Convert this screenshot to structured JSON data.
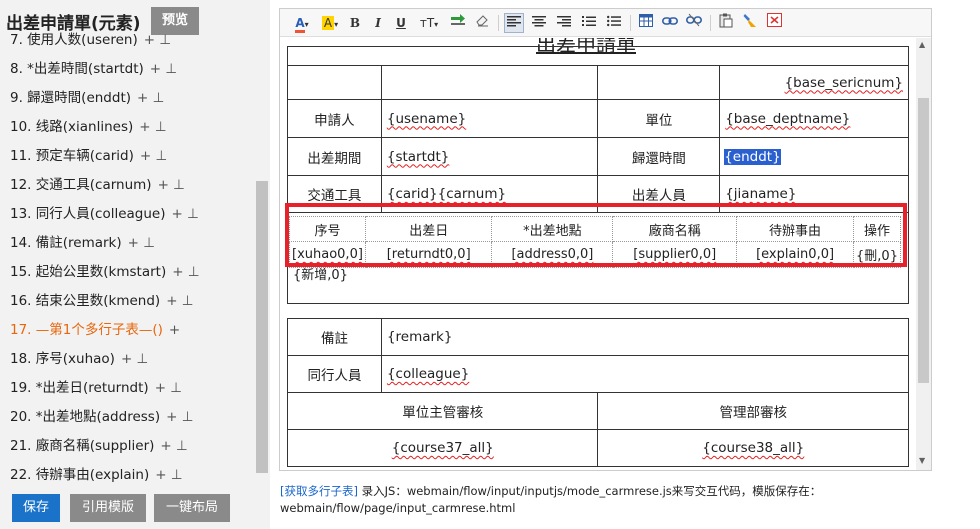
{
  "header": {
    "title": "出差申請單(元素)",
    "preview_label": "预览"
  },
  "field_list": [
    {
      "text": "7. 使用人数(useren)",
      "op": "+ ⊥",
      "sub": false
    },
    {
      "text": "8. *出差時間(startdt)",
      "op": "+ ⊥",
      "sub": false
    },
    {
      "text": "9. 歸還時間(enddt)",
      "op": "+ ⊥",
      "sub": false
    },
    {
      "text": "10. 线路(xianlines)",
      "op": "+ ⊥",
      "sub": false
    },
    {
      "text": "11. 预定车辆(carid)",
      "op": "+ ⊥",
      "sub": false
    },
    {
      "text": "12. 交通工具(carnum)",
      "op": "+ ⊥",
      "sub": false
    },
    {
      "text": "13. 同行人員(colleague)",
      "op": "+ ⊥",
      "sub": false
    },
    {
      "text": "14. 備註(remark)",
      "op": "+ ⊥",
      "sub": false
    },
    {
      "text": "15. 起始公里数(kmstart)",
      "op": "+ ⊥",
      "sub": false
    },
    {
      "text": "16. 结束公里数(kmend)",
      "op": "+ ⊥",
      "sub": false
    },
    {
      "text": "17. —第1个多行子表—()",
      "op": "+",
      "sub": true
    },
    {
      "text": "18. 序号(xuhao)",
      "op": "+ ⊥",
      "sub": false
    },
    {
      "text": "19. *出差日(returndt)",
      "op": "+ ⊥",
      "sub": false
    },
    {
      "text": "20. *出差地點(address)",
      "op": "+ ⊥",
      "sub": false
    },
    {
      "text": "21. 廠商名稱(supplier)",
      "op": "+ ⊥",
      "sub": false
    },
    {
      "text": "22. 待辦事由(explain)",
      "op": "+ ⊥",
      "sub": false
    }
  ],
  "left_buttons": {
    "save": "保存",
    "template": "引用模版",
    "layout": "一键布局"
  },
  "toolbar": {
    "font_color": "A",
    "highlight": "A",
    "bold": "B",
    "italic": "I",
    "underline": "U",
    "font_size": "тT",
    "arrow": "▾"
  },
  "doc": {
    "title": "出差申請單",
    "serial": "{base_sericnum}",
    "applicant_label": "申請人",
    "applicant_value": "{usename}",
    "dept_label": "單位",
    "dept_value": "{base_deptname}",
    "period_label": "出差期間",
    "period_value": "{startdt}",
    "return_label": "歸還時間",
    "return_value": "{enddt}",
    "transport_label": "交通工具",
    "transport_value": "{carid}{carnum}",
    "traveler_label": "出差人員",
    "traveler_value": "{jianame}",
    "sub_headers": [
      "序号",
      "出差日",
      "*出差地點",
      "廠商名稱",
      "待辦事由",
      "操作"
    ],
    "sub_row": [
      "[xuhao0,0]",
      "[returndt0,0]",
      "[address0,0]",
      "[supplier0,0]",
      "[explain0,0]",
      "{刪,0}"
    ],
    "new_row": "{新增,0}",
    "remark_label": "備註",
    "remark_value": "{remark}",
    "colleague_label": "同行人員",
    "colleague_value": "{colleague}",
    "review1_label": "單位主管審核",
    "review2_label": "管理部審核",
    "review1_value": "{course37_all}",
    "review2_value": "{course38_all}"
  },
  "note": {
    "link": "[获取多行子表]",
    "text": " 录入JS：webmain/flow/input/inputjs/mode_carmrese.js来写交互代码，模版保存在：webmain/flow/page/input_carmrese.html"
  },
  "colors": {
    "accent": "#1a73c9",
    "highlight_box": "#e8202a",
    "sub_item": "#e8670c"
  }
}
